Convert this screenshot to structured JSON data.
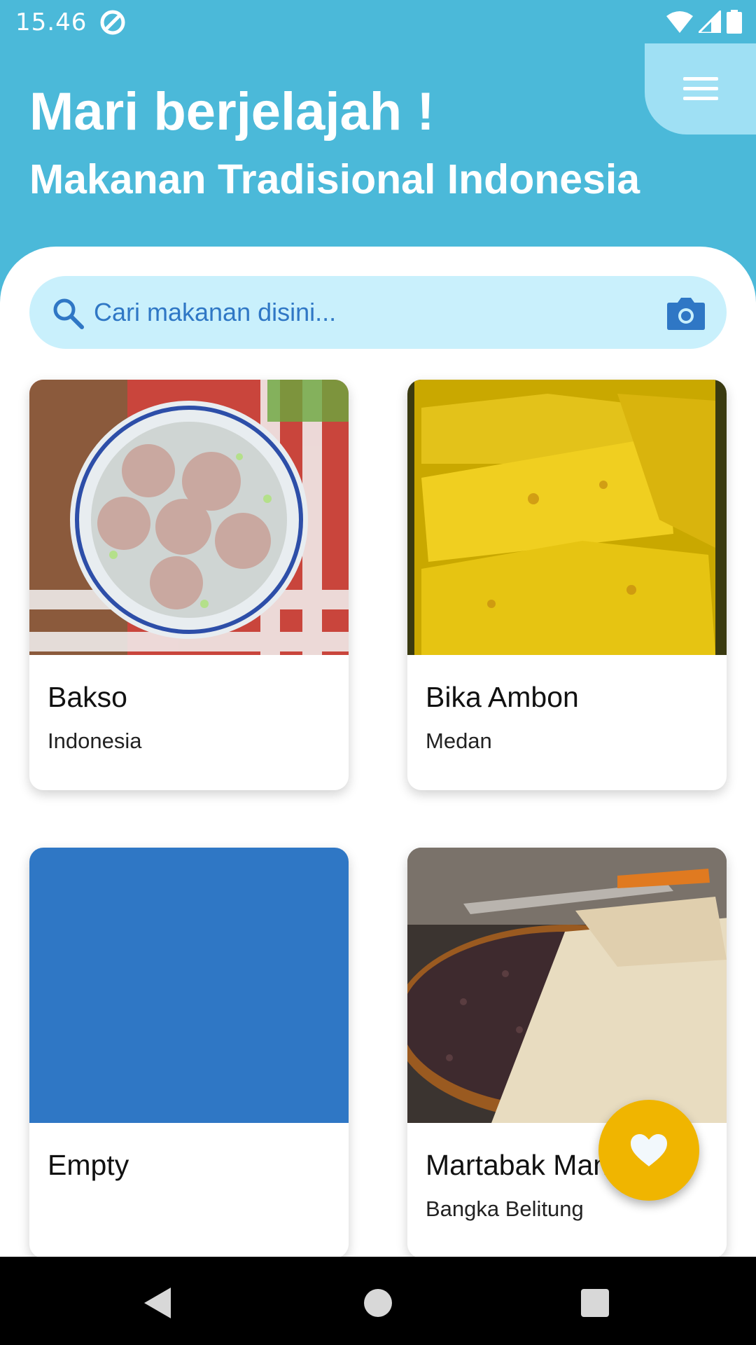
{
  "status_bar": {
    "time": "15.46",
    "app_icon": "notification-app-icon",
    "icons": [
      "wifi-icon",
      "signal-icon",
      "battery-icon"
    ]
  },
  "header": {
    "title": "Mari berjelajah !",
    "subtitle": "Makanan Tradisional Indonesia",
    "menu_icon": "hamburger-menu-icon"
  },
  "search": {
    "placeholder": "Cari makanan disini...",
    "search_icon": "search-icon",
    "camera_icon": "camera-icon"
  },
  "foods": [
    {
      "name": "Bakso",
      "origin": "Indonesia"
    },
    {
      "name": "Bika Ambon",
      "origin": "Medan"
    },
    {
      "name": "Empty",
      "origin": ""
    },
    {
      "name": "Martabak Manis",
      "origin": "Bangka Belitung"
    }
  ],
  "fab": {
    "icon": "heart-icon"
  },
  "navbar": {
    "icons": [
      "back-icon",
      "home-icon",
      "recents-icon"
    ]
  },
  "colors": {
    "header_bg": "#4bb9d9",
    "menu_bg": "#9fe0f4",
    "search_bg": "#c9f0fc",
    "accent_blue": "#2f77c5",
    "fab": "#f0b500",
    "empty_card": "#2f77c5"
  }
}
